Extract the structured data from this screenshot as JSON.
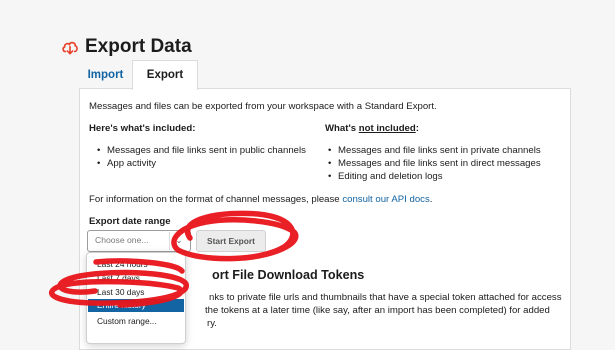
{
  "page": {
    "title": "Export Data",
    "icon": "cloud-download-icon",
    "accent": "#e8402a"
  },
  "tabs": [
    {
      "label": "Import",
      "active": false
    },
    {
      "label": "Export",
      "active": true
    }
  ],
  "intro": "Messages and files can be exported from your workspace with a Standard Export.",
  "included": {
    "heading": "Here's what's included:",
    "items": [
      "Messages and file links sent in public channels",
      "App activity"
    ]
  },
  "not_included": {
    "heading_prefix": "What's ",
    "heading_underlined": "not included",
    "heading_suffix": ":",
    "items": [
      "Messages and file links sent in private channels",
      "Messages and file links sent in direct messages",
      "Editing and deletion logs"
    ]
  },
  "info": {
    "prefix": "For information on the format of channel messages, please ",
    "link": "consult our API docs",
    "suffix": "."
  },
  "date_range": {
    "label": "Export date range",
    "placeholder": "Choose one...",
    "button": "Start Export",
    "options": [
      "Last 24 hours",
      "Last 7 days",
      "Last 30 days",
      "Entire history",
      "Custom range..."
    ],
    "selected_index": 3,
    "selected_color": "#1264a3"
  },
  "tokens": {
    "heading": "ort File Download Tokens",
    "lines": [
      "nks to private file urls and thumbnails that have a special token attached for access",
      " the tokens at a later time (like say, after an import has been completed) for added",
      "ry."
    ]
  },
  "annotation_color": "#e8141a"
}
